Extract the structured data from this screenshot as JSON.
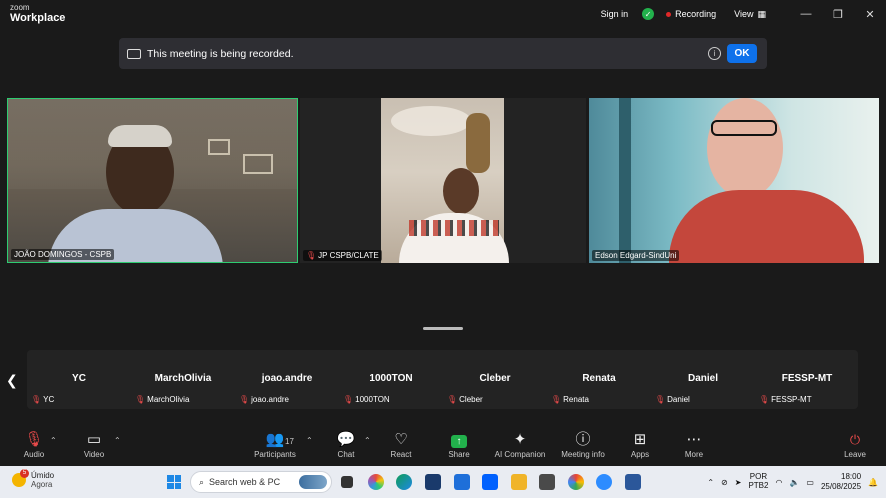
{
  "titlebar": {
    "brand_line1": "zoom",
    "brand_line2": "Workplace",
    "sign_in": "Sign in",
    "recording": "Recording",
    "view": "View"
  },
  "banner": {
    "message": "This meeting is being recorded.",
    "ok": "OK"
  },
  "tiles": [
    {
      "name": "JOÃO DOMINGOS - CSPB",
      "muted": false,
      "active_speaker": true
    },
    {
      "name": "JP CSPB/CLATE",
      "muted": true
    },
    {
      "name": "Edson Edgard-SindUni",
      "muted": false
    }
  ],
  "gallery": [
    {
      "display": "YC",
      "name": "YC"
    },
    {
      "display": "MarchOlivia",
      "name": "MarchOlivia"
    },
    {
      "display": "joao.andre",
      "name": "joao.andre"
    },
    {
      "display": "1000TON",
      "name": "1000TON"
    },
    {
      "display": "Cleber",
      "name": "Cleber"
    },
    {
      "display": "Renata",
      "name": "Renata"
    },
    {
      "display": "Daniel",
      "name": "Daniel"
    },
    {
      "display": "FESSP-MT",
      "name": "FESSP-MT"
    }
  ],
  "toolbar": {
    "audio": "Audio",
    "video": "Video",
    "participants": "Participants",
    "participants_count": "17",
    "chat": "Chat",
    "react": "React",
    "share": "Share",
    "ai_companion": "AI Companion",
    "meeting_info": "Meeting info",
    "apps": "Apps",
    "more": "More",
    "leave": "Leave"
  },
  "taskbar": {
    "weather_badge": "5",
    "weather_condition": "Úmido",
    "weather_time": "Agora",
    "search_placeholder": "Search web & PC",
    "lang_line1": "POR",
    "lang_line2": "PTB2",
    "time": "18:00",
    "date": "25/08/2025"
  },
  "colors": {
    "active_speaker_border": "#2ecc71",
    "ok_button": "#0e71eb",
    "recording_dot": "#e02828",
    "share_button": "#22b14c",
    "muted_icon": "#e84a4a"
  }
}
